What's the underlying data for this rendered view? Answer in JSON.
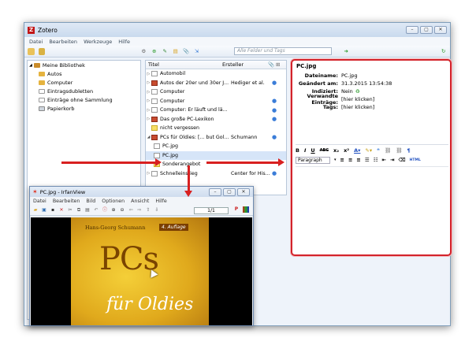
{
  "window": {
    "title": "Zotero"
  },
  "menu": [
    "Datei",
    "Bearbeiten",
    "Werkzeuge",
    "Hilfe"
  ],
  "search": {
    "placeholder": "Alle Felder und Tags"
  },
  "library": {
    "root": "Meine Bibliothek",
    "items": [
      "Autos",
      "Computer",
      "Eintragsdubletten",
      "Einträge ohne Sammlung",
      "Papierkorb"
    ]
  },
  "list": {
    "col_title": "Titel",
    "col_creator": "Ersteller",
    "rows": [
      {
        "title": "Automobil",
        "creator": "",
        "dot": "",
        "icon": "doc",
        "tw": "▷",
        "sel": false
      },
      {
        "title": "Autos der 20er und 30er J...",
        "creator": "Hediger et al.",
        "dot": "●",
        "icon": "book",
        "tw": "▷",
        "sel": false
      },
      {
        "title": "Computer",
        "creator": "",
        "dot": "",
        "icon": "doc",
        "tw": "▷",
        "sel": false
      },
      {
        "title": "Computer",
        "creator": "",
        "dot": "●",
        "icon": "doc",
        "tw": "▷",
        "sel": false
      },
      {
        "title": "Computer: Er läuft und lä...",
        "creator": "",
        "dot": "●",
        "icon": "doc",
        "tw": "▷",
        "sel": false
      },
      {
        "title": "Das große PC-Lexikon",
        "creator": "",
        "dot": "●",
        "icon": "book",
        "tw": "▷",
        "sel": false
      },
      {
        "title": "nicht vergessen",
        "creator": "",
        "dot": "",
        "icon": "note",
        "tw": "",
        "sel": false
      },
      {
        "title": "PCs für Oldies: [... but Gol...",
        "creator": "Schumann",
        "dot": "●",
        "icon": "book",
        "tw": "◢",
        "sel": false
      },
      {
        "title": "PC.jpg",
        "creator": "",
        "dot": "",
        "icon": "doc",
        "tw": "",
        "sel": false
      },
      {
        "title": "PC.jpg",
        "creator": "",
        "dot": "",
        "icon": "doc",
        "tw": "",
        "sel": true
      },
      {
        "title": "Sonderangebot",
        "creator": "",
        "dot": "",
        "icon": "note",
        "tw": "",
        "sel": false
      },
      {
        "title": "Schnelleinstieg",
        "creator": "Center for His...",
        "dot": "●",
        "icon": "doc",
        "tw": "▷",
        "sel": false
      }
    ]
  },
  "detail": {
    "title": "PC.jpg",
    "fields": [
      {
        "k": "Dateiname:",
        "v": "PC.jpg"
      },
      {
        "k": "Geändert am:",
        "v": "31.3.2015 13:54:38"
      },
      {
        "k": "Indiziert:",
        "v": "Nein"
      },
      {
        "k": "Verwandte Einträge:",
        "v": "[hier klicken]"
      },
      {
        "k": "Tags:",
        "v": "[hier klicken]"
      }
    ],
    "paragraph": "Paragraph"
  },
  "irfan": {
    "title": "PC.jpg - IrfanView",
    "menu": [
      "Datei",
      "Bearbeiten",
      "Bild",
      "Optionen",
      "Ansicht",
      "Hilfe"
    ],
    "page": "1/1",
    "cover_author": "Hans-Georg Schumann",
    "cover_edition": "4. Auflage",
    "cover_big": "PCs",
    "cover_sub": "für Oldies"
  },
  "colors": {
    "accent": "#d3232b",
    "arrow": "#d82020"
  }
}
